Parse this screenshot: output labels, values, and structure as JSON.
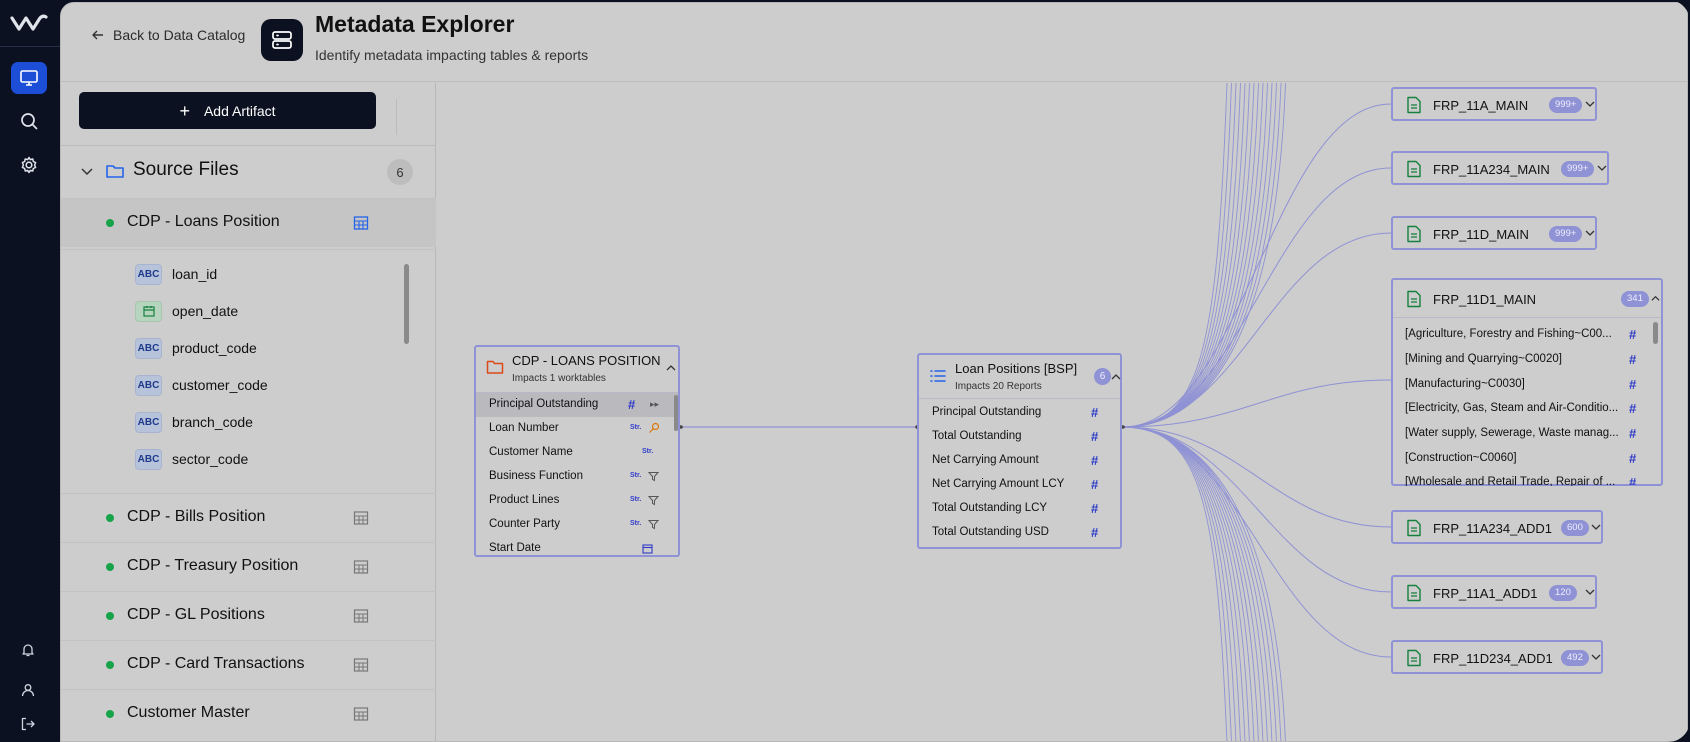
{
  "rail": {
    "icons": [
      "logo-icon",
      "monitor-icon",
      "search-icon",
      "gear-icon",
      "bell-icon",
      "user-icon",
      "logout-icon"
    ]
  },
  "header": {
    "back_label": "Back to Data Catalog",
    "title": "Metadata Explorer",
    "subtitle": "Identify metadata impacting tables & reports"
  },
  "left": {
    "add_label": "Add Artifact",
    "source_files_label": "Source Files",
    "source_files_count": "6",
    "sources": [
      {
        "name": "CDP - Loans Position",
        "active": true
      },
      {
        "name": "CDP - Bills Position"
      },
      {
        "name": "CDP - Treasury Position"
      },
      {
        "name": "CDP - GL Positions"
      },
      {
        "name": "CDP - Card Transactions"
      },
      {
        "name": "Customer Master"
      }
    ],
    "columns": [
      {
        "badge": "ABC",
        "name": "loan_id"
      },
      {
        "badge": "calendar",
        "name": "open_date"
      },
      {
        "badge": "ABC",
        "name": "product_code"
      },
      {
        "badge": "ABC",
        "name": "customer_code"
      },
      {
        "badge": "ABC",
        "name": "branch_code"
      },
      {
        "badge": "ABC",
        "name": "sector_code"
      }
    ]
  },
  "nodes": {
    "source": {
      "title": "CDP - LOANS POSITION",
      "subtitle": "Impacts 1 worktables",
      "rows": [
        {
          "label": "Principal Outstanding",
          "type": "#"
        },
        {
          "label": "Loan Number",
          "type": "Str."
        },
        {
          "label": "Customer Name",
          "type": "Str."
        },
        {
          "label": "Business Function",
          "type": "Str."
        },
        {
          "label": "Product Lines",
          "type": "Str."
        },
        {
          "label": "Counter Party",
          "type": "Str."
        },
        {
          "label": "Start Date",
          "type": "calendar"
        }
      ]
    },
    "worktable": {
      "title": "Loan Positions [BSP]",
      "subtitle": "Impacts 20 Reports",
      "count": "6",
      "rows": [
        {
          "label": "Principal Outstanding",
          "type": "#"
        },
        {
          "label": "Total Outstanding",
          "type": "#"
        },
        {
          "label": "Net Carrying Amount",
          "type": "#"
        },
        {
          "label": "Net Carrying Amount LCY",
          "type": "#"
        },
        {
          "label": "Total Outstanding LCY",
          "type": "#"
        },
        {
          "label": "Total Outstanding USD",
          "type": "#"
        }
      ]
    },
    "reports": [
      {
        "name": "FRP_11A_MAIN",
        "count": "999+"
      },
      {
        "name": "FRP_11A234_MAIN",
        "count": "999+"
      },
      {
        "name": "FRP_11D_MAIN",
        "count": "999+"
      },
      {
        "name": "FRP_11A234_ADD1",
        "count": "600"
      },
      {
        "name": "FRP_11A1_ADD1",
        "count": "120"
      },
      {
        "name": "FRP_11D234_ADD1",
        "count": "492"
      }
    ],
    "expanded_report": {
      "name": "FRP_11D1_MAIN",
      "count": "341",
      "rows": [
        "[Agriculture, Forestry and Fishing~C00...",
        "[Mining and Quarrying~C0020]",
        "[Manufacturing~C0030]",
        "[Electricity, Gas, Steam and Air-Conditio...",
        "[Water supply, Sewerage, Waste manag...",
        "[Construction~C0060]",
        "[Wholesale and Retail Trade, Repair of ..."
      ]
    }
  },
  "colors": {
    "accent": "#1d4ed8",
    "node_border": "#8f92d4",
    "status_green": "#16a34a",
    "dark": "#0b1120"
  }
}
